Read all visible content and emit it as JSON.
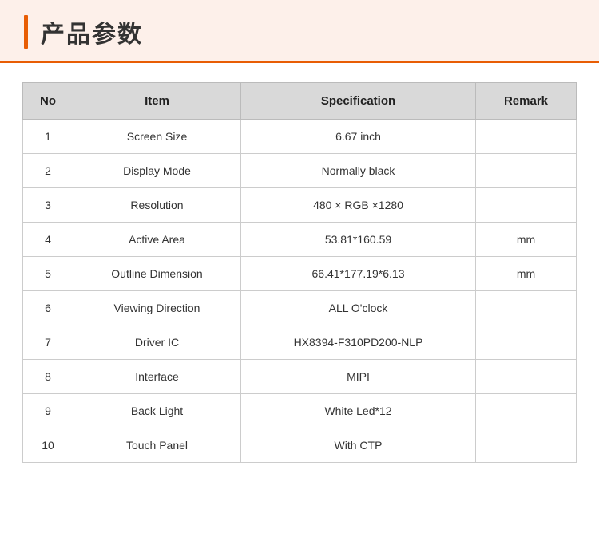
{
  "header": {
    "title": "产品参数",
    "bar_color": "#e85d04",
    "bg_color": "#fdf0ea"
  },
  "table": {
    "columns": [
      {
        "key": "no",
        "label": "No"
      },
      {
        "key": "item",
        "label": "Item"
      },
      {
        "key": "specification",
        "label": "Specification"
      },
      {
        "key": "remark",
        "label": "Remark"
      }
    ],
    "rows": [
      {
        "no": "1",
        "item": "Screen Size",
        "specification": "6.67 inch",
        "remark": ""
      },
      {
        "no": "2",
        "item": "Display Mode",
        "specification": "Normally black",
        "remark": ""
      },
      {
        "no": "3",
        "item": "Resolution",
        "specification": "480 × RGB ×1280",
        "remark": ""
      },
      {
        "no": "4",
        "item": "Active Area",
        "specification": "53.81*160.59",
        "remark": "mm"
      },
      {
        "no": "5",
        "item": "Outline Dimension",
        "specification": "66.41*177.19*6.13",
        "remark": "mm"
      },
      {
        "no": "6",
        "item": "Viewing Direction",
        "specification": "ALL O'clock",
        "remark": ""
      },
      {
        "no": "7",
        "item": "Driver IC",
        "specification": "HX8394-F310PD200-NLP",
        "remark": ""
      },
      {
        "no": "8",
        "item": "Interface",
        "specification": "MIPI",
        "remark": ""
      },
      {
        "no": "9",
        "item": "Back Light",
        "specification": "White Led*12",
        "remark": ""
      },
      {
        "no": "10",
        "item": "Touch Panel",
        "specification": "With CTP",
        "remark": ""
      }
    ]
  }
}
